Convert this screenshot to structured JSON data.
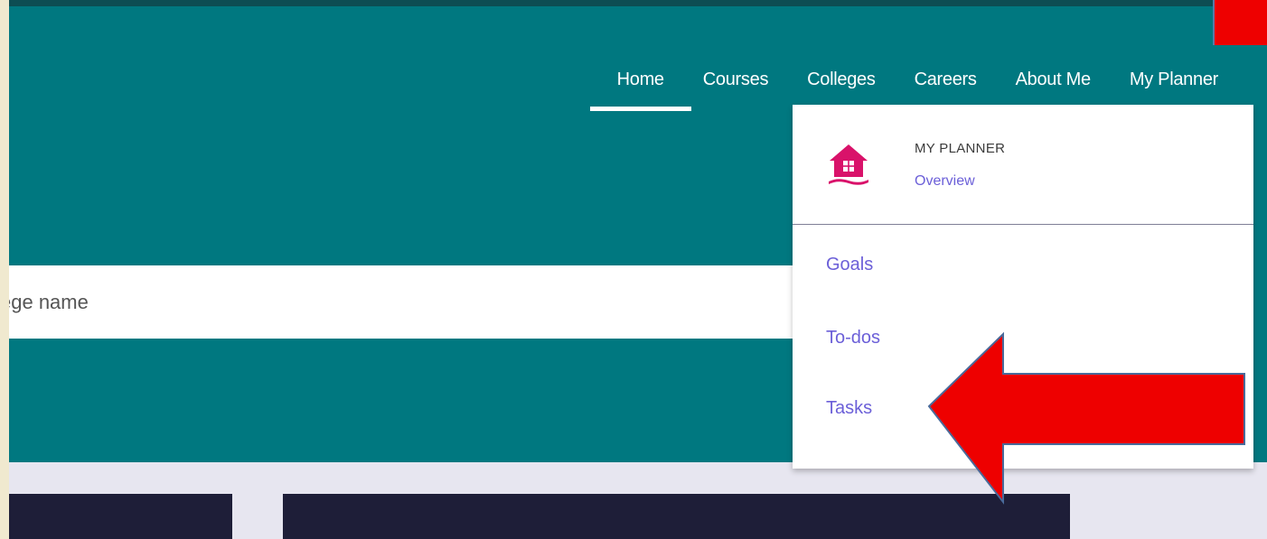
{
  "nav": {
    "items": [
      {
        "label": "Home",
        "active": true
      },
      {
        "label": "Courses",
        "active": false
      },
      {
        "label": "Colleges",
        "active": false
      },
      {
        "label": "Careers",
        "active": false
      },
      {
        "label": "About Me",
        "active": false
      },
      {
        "label": "My Planner",
        "active": false
      }
    ]
  },
  "search": {
    "placeholder": "ege name"
  },
  "dropdown": {
    "icon": "house-icon",
    "title": "MY PLANNER",
    "overview": "Overview",
    "items": [
      {
        "label": "Goals"
      },
      {
        "label": "To-dos"
      },
      {
        "label": "Tasks"
      }
    ]
  },
  "colors": {
    "hero": "#007880",
    "accent_link": "#6b5fd8",
    "icon_pink": "#d9126a",
    "annotation_red": "#ee0000",
    "card_dark": "#1e1e38"
  }
}
